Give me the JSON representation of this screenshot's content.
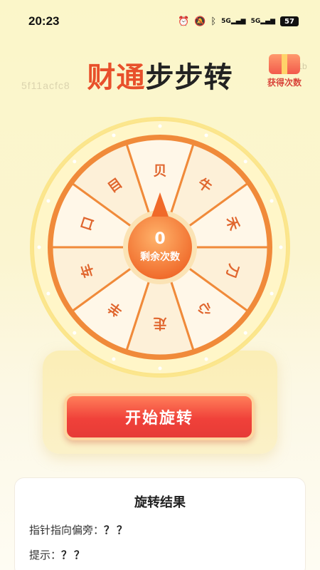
{
  "status_bar": {
    "time": "20:23",
    "signal1": "5G",
    "signal2": "5G",
    "battery": "57"
  },
  "watermark": {
    "left": "5f11acfc8",
    "right": "ad1b"
  },
  "header": {
    "title_part1": "财通",
    "title_part2": "步步转",
    "get_times_label": "获得次数"
  },
  "wheel": {
    "segments": [
      "贝",
      "牛",
      "禾",
      "刀",
      "心",
      "走",
      "羊",
      "车",
      "口",
      "目"
    ],
    "center_count": "0",
    "center_label": "剩余次数"
  },
  "start_button": {
    "label": "开始旋转"
  },
  "result": {
    "title": "旋转结果",
    "pointer_label": "指针指向偏旁：",
    "pointer_value": "？？",
    "hint_label": "提示：",
    "hint_value": "？？"
  },
  "colors": {
    "accent": "#f08a3a",
    "title_red": "#e8502b",
    "button_red": "#f0413a"
  }
}
